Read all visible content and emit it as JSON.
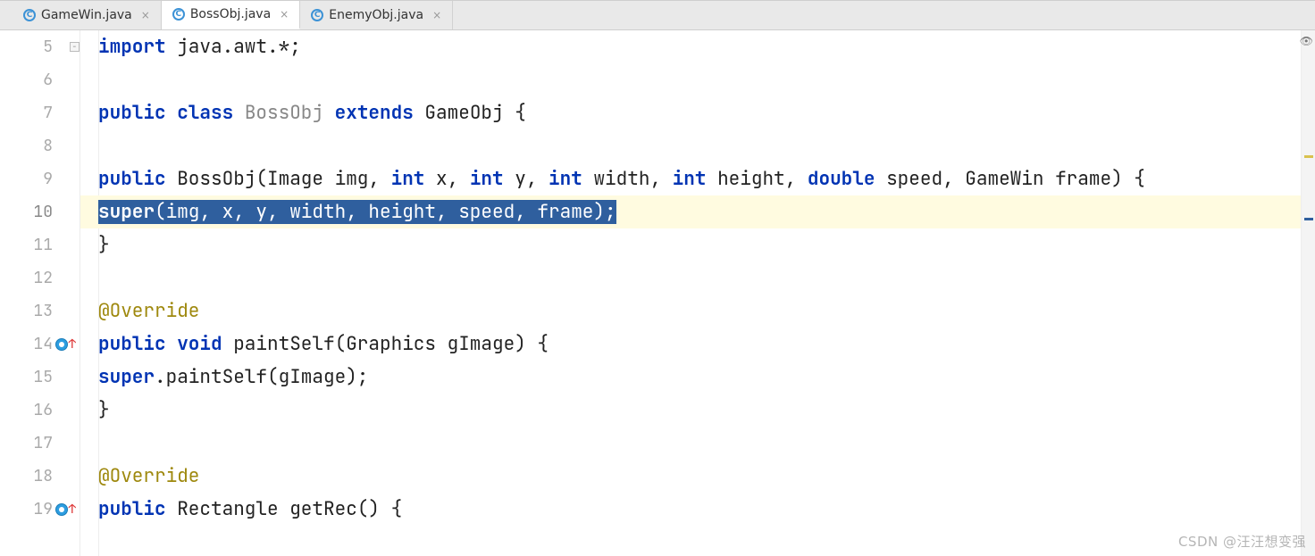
{
  "tabs": [
    {
      "label": "GameWin.java"
    },
    {
      "label": "BossObj.java"
    },
    {
      "label": "EnemyObj.java"
    }
  ],
  "activeTab": 1,
  "lineStart": 5,
  "lines": {
    "l5": {
      "num": "5",
      "t_import": "import ",
      "t_pkg": "java.awt.*;"
    },
    "l6": {
      "num": "6"
    },
    "l7": {
      "num": "7",
      "t_public": "public ",
      "t_class": "class ",
      "t_name": "BossObj",
      "t_extends": " extends ",
      "t_parent": "GameObj {",
      "fold": "−"
    },
    "l8": {
      "num": "8"
    },
    "l9": {
      "num": "9",
      "t_public": "public ",
      "t_ctor": "BossObj(Image img, ",
      "t_int1": "int ",
      "t_x": "x, ",
      "t_int2": "int ",
      "t_y": "y, ",
      "t_int3": "int ",
      "t_w": "width, ",
      "t_int4": "int ",
      "t_h": "height, ",
      "t_dbl": "double ",
      "t_sp": "speed, GameWin frame) {",
      "fold": "−"
    },
    "l10": {
      "num": "10",
      "t_super": "super",
      "t_args": "(img, x, y, width, height, speed, frame);"
    },
    "l11": {
      "num": "11",
      "t": "}",
      "fold": "−"
    },
    "l12": {
      "num": "12"
    },
    "l13": {
      "num": "13",
      "t": "@Override"
    },
    "l14": {
      "num": "14",
      "t_public": "public ",
      "t_void": "void ",
      "t_sig": "paintSelf(Graphics gImage) {",
      "fold": "−"
    },
    "l15": {
      "num": "15",
      "t_super": "super",
      "t_call": ".paintSelf(gImage);"
    },
    "l16": {
      "num": "16",
      "t": "}",
      "fold": "−"
    },
    "l17": {
      "num": "17"
    },
    "l18": {
      "num": "18",
      "t": "@Override"
    },
    "l19": {
      "num": "19",
      "t_public": "public ",
      "t_ret": "Rectangle getRec() {",
      "fold": "−"
    }
  },
  "watermark": "CSDN @汪汪想变强",
  "icon_letter": "C",
  "close_glyph": "×",
  "eye_glyph": "👁"
}
